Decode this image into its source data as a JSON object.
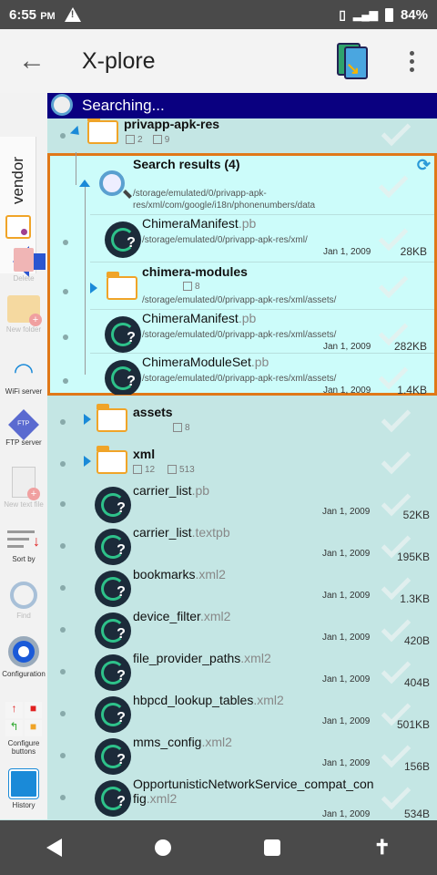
{
  "status": {
    "time": "6:55",
    "ampm": "PM",
    "battery": "84%"
  },
  "appbar": {
    "title": "X-plore"
  },
  "search_banner": "Searching...",
  "sidebar": {
    "vendor_tab": "vendor",
    "tools": [
      {
        "label": "Delete"
      },
      {
        "label": "New folder"
      },
      {
        "label": "WiFi server"
      },
      {
        "label": "FTP server"
      },
      {
        "label": "New text file"
      },
      {
        "label": "Sort by"
      },
      {
        "label": "Find"
      },
      {
        "label": "Configuration"
      },
      {
        "label": "Configure buttons"
      },
      {
        "label": "History"
      }
    ]
  },
  "tree": {
    "parent_folder": {
      "name": "privapp-apk-res",
      "subfolders": "2",
      "files": "9"
    },
    "search_results": {
      "title": "Search results (4)",
      "path": "/storage/emulated/0/privapp-apk-res/xml/com/google/i18n/phonenumbers/data",
      "items": [
        {
          "name": "ChimeraManifest",
          "ext": ".pb",
          "path": "/storage/emulated/0/privapp-apk-res/xml/",
          "date": "Jan 1, 2009",
          "size": "28KB"
        },
        {
          "name": "chimera-modules",
          "ext": "",
          "files": "8",
          "path": "/storage/emulated/0/privapp-apk-res/xml/assets/"
        },
        {
          "name": "ChimeraManifest",
          "ext": ".pb",
          "path": "/storage/emulated/0/privapp-apk-res/xml/assets/",
          "date": "Jan 1, 2009",
          "size": "282KB"
        },
        {
          "name": "ChimeraModuleSet",
          "ext": ".pb",
          "path": "/storage/emulated/0/privapp-apk-res/xml/assets/",
          "date": "Jan 1, 2009",
          "size": "1.4KB"
        }
      ]
    },
    "folders": [
      {
        "name": "assets",
        "files": "8"
      },
      {
        "name": "xml",
        "subfolders": "12",
        "files": "513"
      }
    ],
    "files": [
      {
        "name": "carrier_list",
        "ext": ".pb",
        "date": "Jan 1, 2009",
        "size": "52KB"
      },
      {
        "name": "carrier_list",
        "ext": ".textpb",
        "date": "Jan 1, 2009",
        "size": "195KB"
      },
      {
        "name": "bookmarks",
        "ext": ".xml2",
        "date": "Jan 1, 2009",
        "size": "1.3KB"
      },
      {
        "name": "device_filter",
        "ext": ".xml2",
        "date": "Jan 1, 2009",
        "size": "420B"
      },
      {
        "name": "file_provider_paths",
        "ext": ".xml2",
        "date": "Jan 1, 2009",
        "size": "404B"
      },
      {
        "name": "hbpcd_lookup_tables",
        "ext": ".xml2",
        "date": "Jan 1, 2009",
        "size": "501KB"
      },
      {
        "name": "mms_config",
        "ext": ".xml2",
        "date": "Jan 1, 2009",
        "size": "156B"
      },
      {
        "name": "OpportunisticNetworkService_compat_con",
        "name2": "fig",
        "ext": ".xml2",
        "date": "Jan 1, 2009",
        "size": "534B"
      }
    ]
  },
  "colors": {
    "search_banner": "#0a0080",
    "highlight_border": "#e07818",
    "list_bg": "#c4e6e4",
    "results_bg": "#ccfcfa"
  }
}
